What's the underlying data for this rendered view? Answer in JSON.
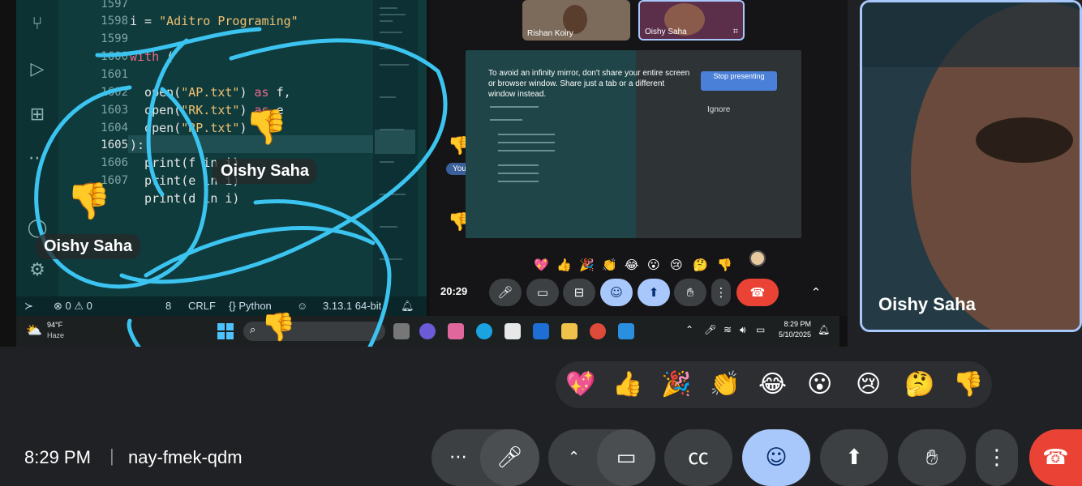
{
  "vscode": {
    "line_numbers": [
      "1597",
      "1598",
      "1599",
      "1600",
      "1601",
      "1602",
      "1603",
      "1604",
      "1605",
      "1606",
      "1607"
    ],
    "code": {
      "l1598_var": "i = ",
      "l1598_str": "\"Aditro Programing\"",
      "l1600_kw": "with",
      "l1600_rest": " (",
      "l1602_a": "  open(",
      "l1602_s": "\"AP.txt\"",
      "l1602_b": ") ",
      "l1602_k": "as",
      "l1602_c": " f,",
      "l1603_a": "  open(",
      "l1603_s": "\"RK.txt\"",
      "l1603_b": ") ",
      "l1603_k": "as",
      "l1603_c": " e",
      "l1604_a": "  open(",
      "l1604_s": "\"RP.txt\"",
      "l1604_b": ")",
      "l1605": "):",
      "l1606": "  print(f in i)",
      "l1607": "  print(e in i)",
      "l1608": "  print(d in i)"
    },
    "status": {
      "errors": "0",
      "warnings": "0",
      "col": "8",
      "eol": "CRLF",
      "lang_braces": "{}",
      "lang": "Python",
      "version": "3.13.1 64-bit"
    }
  },
  "taskbar": {
    "weather_temp": "94°F",
    "weather_desc": "Haze",
    "time": "8:29 PM",
    "date": "5/10/2025"
  },
  "meet_inner": {
    "participants": [
      {
        "name": "Rishan Koiry"
      },
      {
        "name": "Oishy Saha"
      }
    ],
    "warning_text": "To avoid an infinity mirror, don't share your entire screen or browser window. Share just a tab or a different window instead.",
    "stop_button": "Stop presenting",
    "ignore_button": "Ignore",
    "you_badge": "You",
    "clock": "20:29"
  },
  "overlays": {
    "reaction_name_1": "Oishy Saha",
    "reaction_name_2": "Oishy Saha"
  },
  "selfview": {
    "name": "Oishy Saha"
  },
  "reactions": [
    "💖",
    "👍",
    "🎉",
    "👏",
    "😂",
    "😮",
    "😢",
    "🤔",
    "👎"
  ],
  "bottom": {
    "time": "8:29 PM",
    "separator": "|",
    "meeting_code": "nay-fmek-qdm"
  },
  "colors": {
    "accent": "#a8c7fa",
    "end_call": "#ea4335",
    "annotation": "#3cc4f0"
  }
}
